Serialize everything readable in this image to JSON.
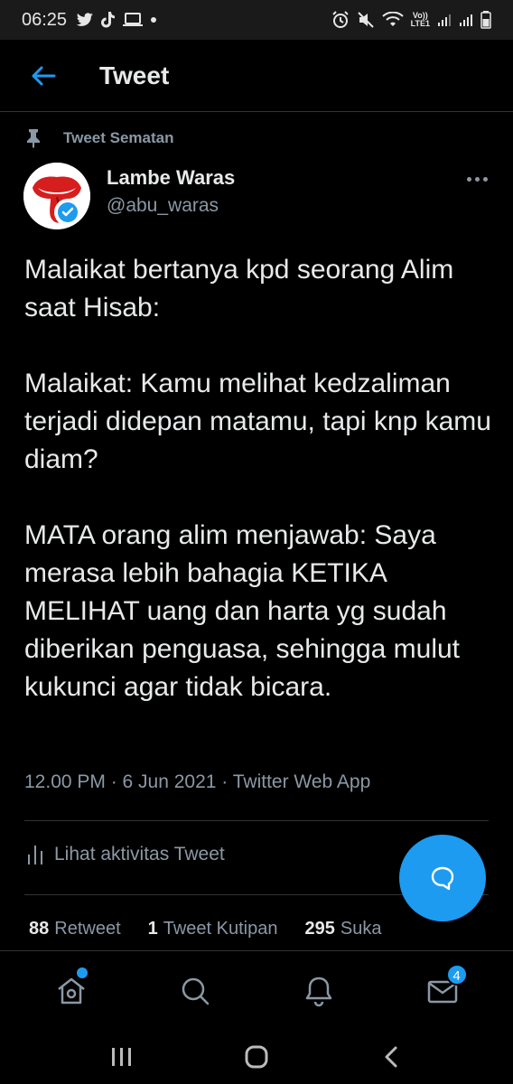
{
  "status_bar": {
    "time": "06:25",
    "lte_top": "Vo))",
    "lte_bottom": "LTE1"
  },
  "header": {
    "title": "Tweet",
    "back_icon": "arrow-left-icon"
  },
  "tweet": {
    "pinned_label": "Tweet Sematan",
    "author_name": "Lambe Waras",
    "author_handle": "@abu_waras",
    "paragraphs": [
      "Malaikat bertanya kpd seorang Alim saat Hisab:",
      "Malaikat: Kamu melihat kedzaliman terjadi didepan matamu, tapi knp kamu diam?",
      "MATA orang alim menjawab: Saya merasa lebih bahagia KETIKA MELIHAT uang dan harta yg sudah diberikan penguasa, sehingga mulut kukunci agar tidak bicara."
    ],
    "timestamp": "12.00 PM · 6 Jun 2021 · Twitter Web App",
    "activity_label": "Lihat aktivitas Tweet",
    "stats": {
      "retweets_count": "88",
      "retweets_label": "Retweet",
      "quotes_count": "1",
      "quotes_label": "Tweet Kutipan",
      "likes_count": "295",
      "likes_label": "Suka"
    }
  },
  "bottom_nav": {
    "items": [
      "home-icon",
      "search-icon",
      "notifications-icon",
      "messages-icon"
    ],
    "messages_badge": "4"
  },
  "colors": {
    "accent": "#1d9bf0",
    "background": "#000000",
    "secondary_text": "#8b98a5"
  }
}
